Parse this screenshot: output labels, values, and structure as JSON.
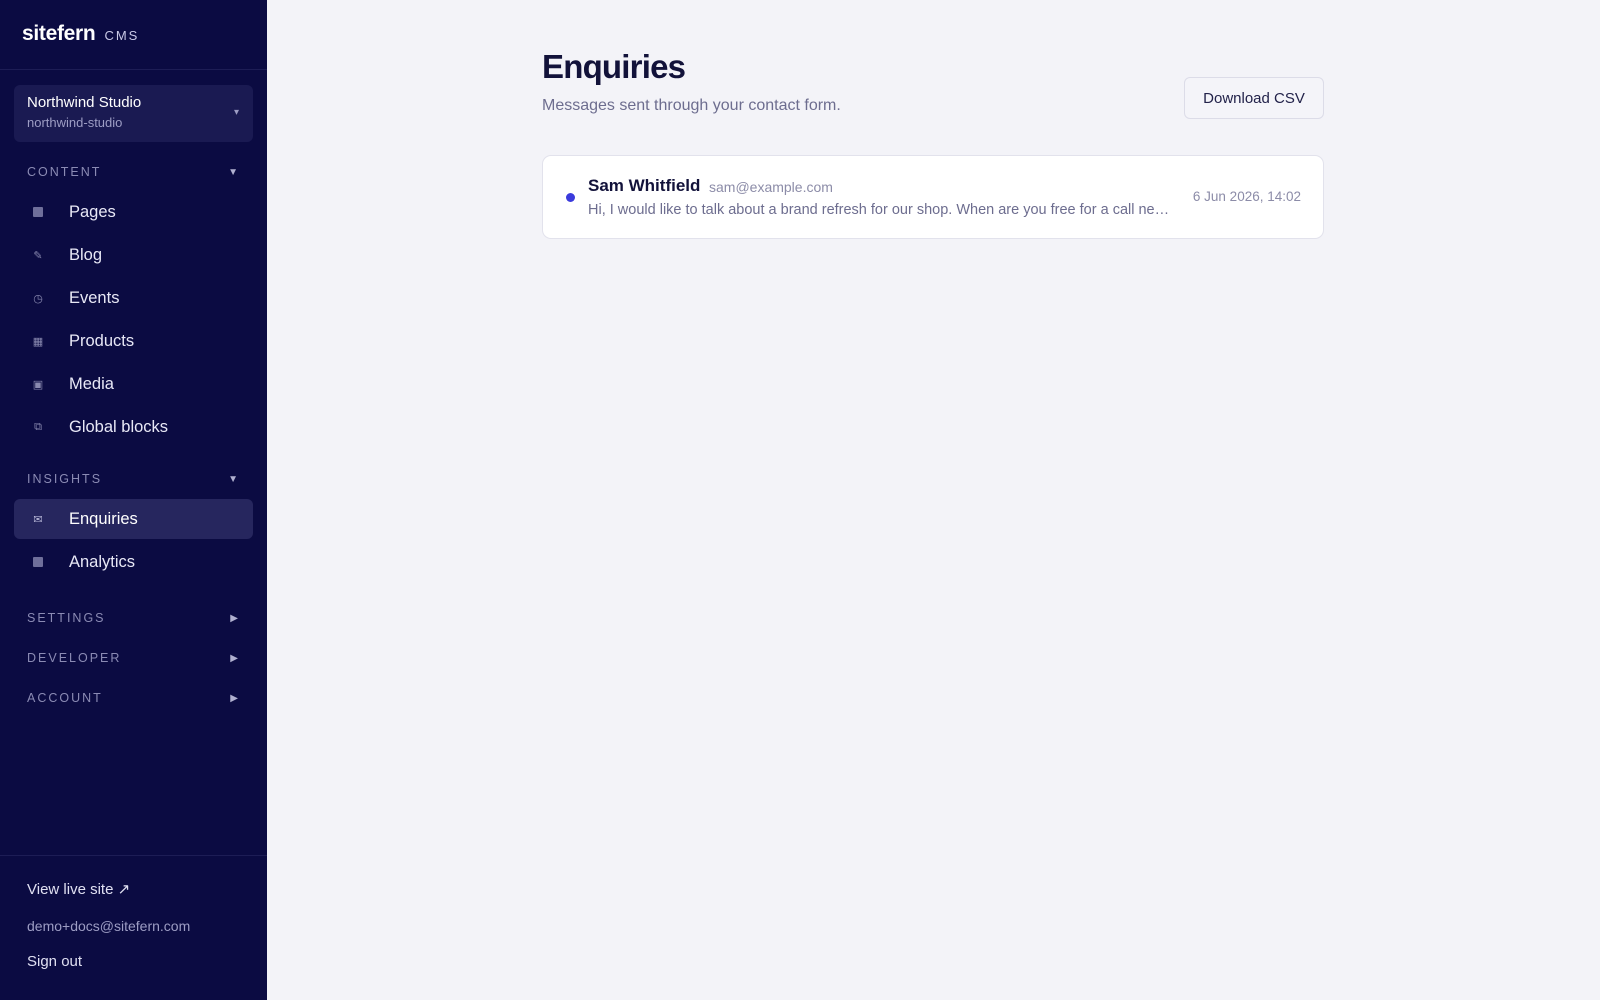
{
  "brand": {
    "name": "sitefern",
    "suffix": "CMS"
  },
  "site": {
    "name": "Northwind Studio",
    "slug": "northwind-studio"
  },
  "sections": {
    "content": {
      "label": "CONTENT",
      "items": [
        {
          "label": "Pages",
          "icon": "pages-icon"
        },
        {
          "label": "Blog",
          "icon": "pencil-icon"
        },
        {
          "label": "Events",
          "icon": "clock-icon"
        },
        {
          "label": "Products",
          "icon": "grid-icon"
        },
        {
          "label": "Media",
          "icon": "image-icon"
        },
        {
          "label": "Global blocks",
          "icon": "copy-icon"
        }
      ]
    },
    "insights": {
      "label": "INSIGHTS",
      "items": [
        {
          "label": "Enquiries",
          "icon": "envelope-icon",
          "active": true
        },
        {
          "label": "Analytics",
          "icon": "chart-icon"
        }
      ]
    },
    "settings": {
      "label": "SETTINGS"
    },
    "developer": {
      "label": "DEVELOPER"
    },
    "account": {
      "label": "ACCOUNT"
    }
  },
  "footer": {
    "view_live_site": "View live site ↗",
    "email": "demo+docs@sitefern.com",
    "sign_out": "Sign out"
  },
  "page": {
    "title": "Enquiries",
    "subtitle": "Messages sent through your contact form.",
    "download_label": "Download CSV"
  },
  "enquiries": [
    {
      "name": "Sam Whitfield",
      "email": "sam@example.com",
      "preview": "Hi, I would like to talk about a brand refresh for our shop. When are you free for a call next week?",
      "received": "6 Jun 2026, 14:02",
      "unread": true
    }
  ],
  "colors": {
    "sidebar_bg": "#0b0b42",
    "accent": "#3b3bdc",
    "active_item_bg": "#26265e",
    "page_bg": "#f3f3f8"
  }
}
